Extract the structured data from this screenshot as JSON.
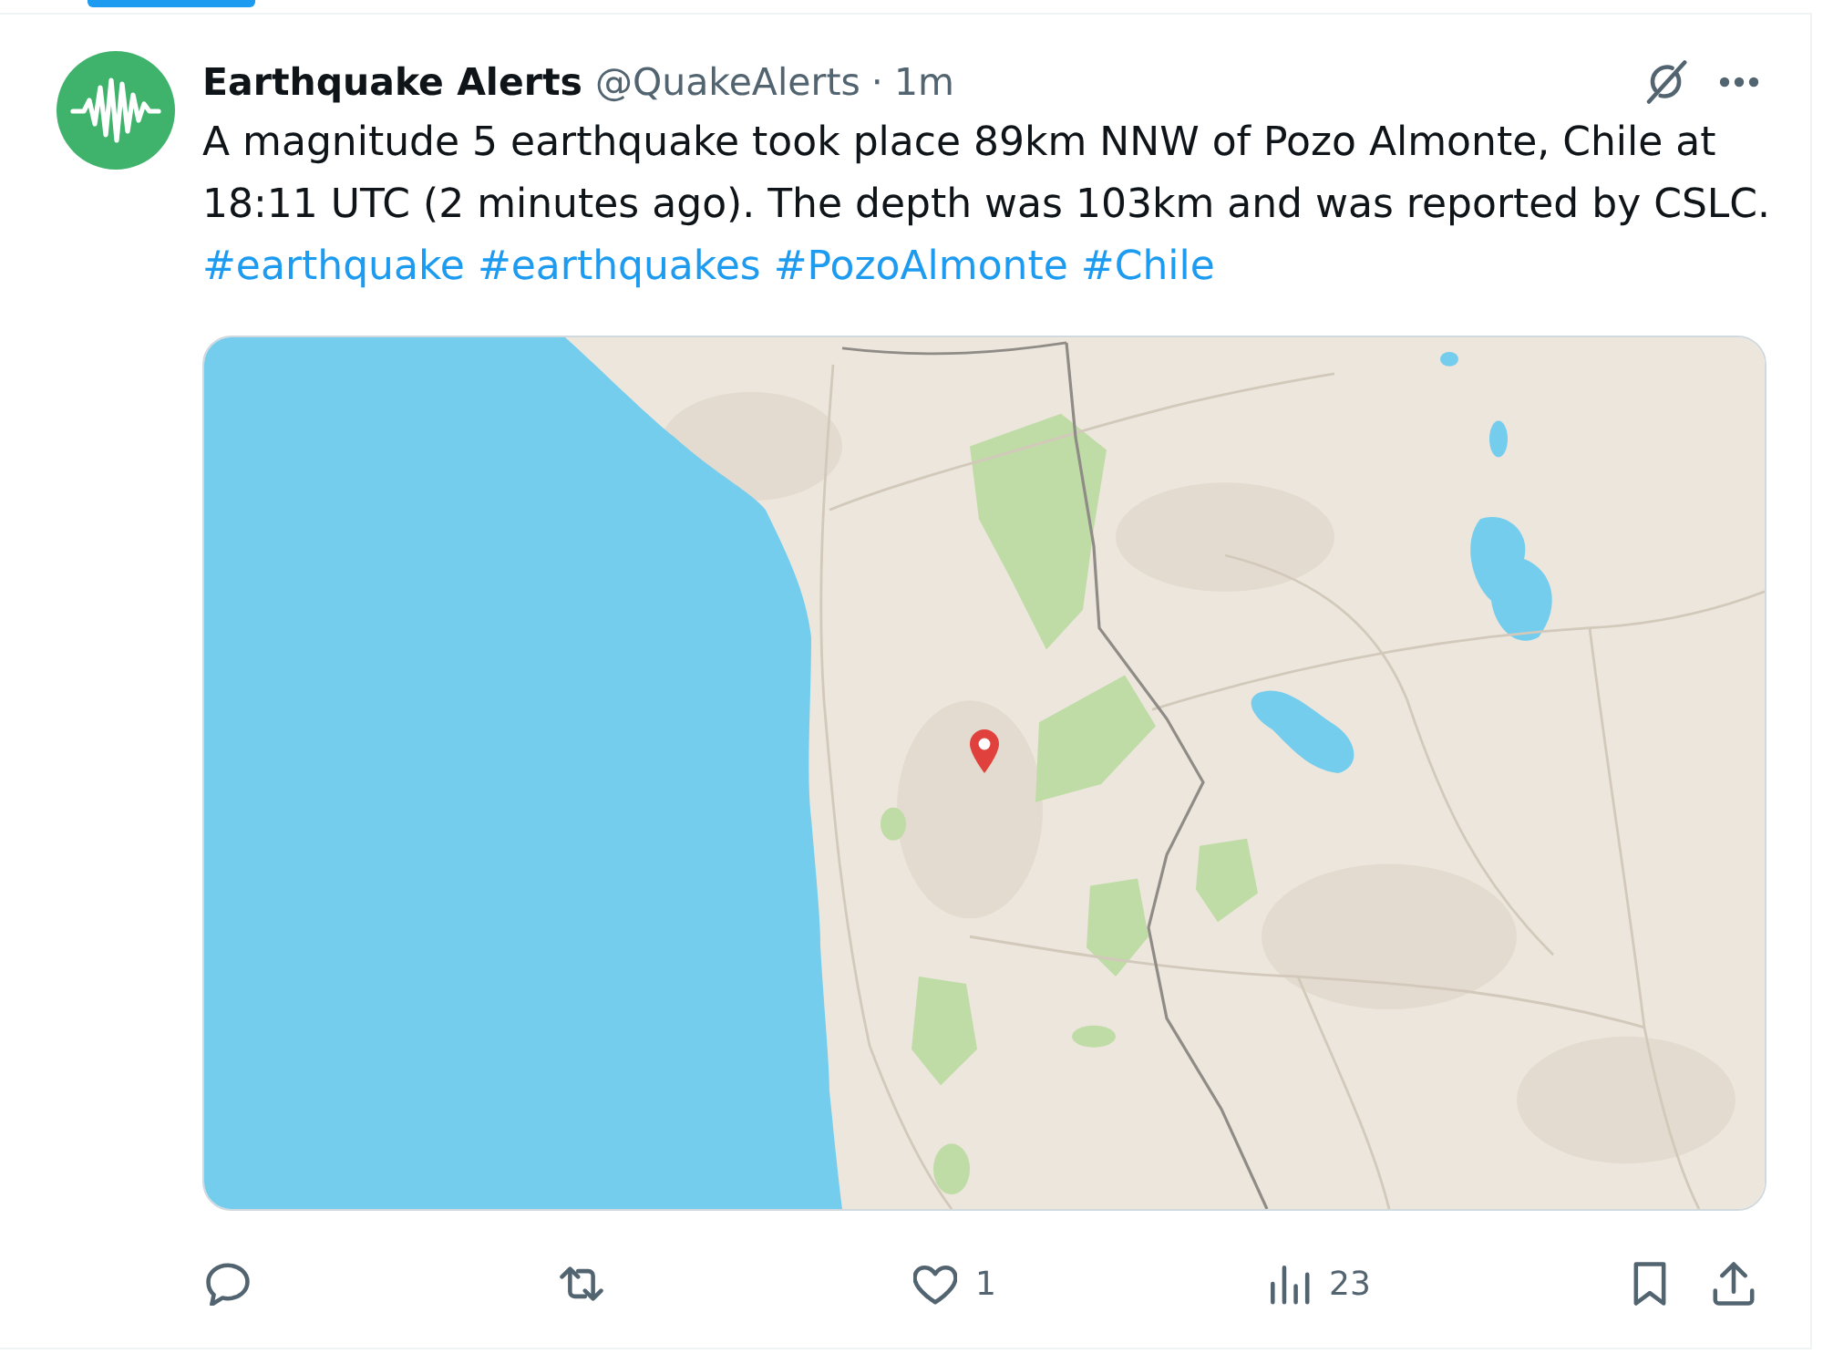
{
  "post": {
    "author": {
      "name": "Earthquake Alerts",
      "handle": "@QuakeAlerts"
    },
    "separator": "·",
    "time": "1m",
    "header_actions": [
      {
        "kind": "slash"
      },
      {
        "kind": "more"
      }
    ],
    "text": "A magnitude 5 earthquake took place 89km NNW of Pozo Almonte, Chile at 18:11 UTC (2 minutes ago). The depth was 103km and was reported by CSLC.",
    "hashtags": [
      "#earthquake",
      "#earthquakes",
      "#PozoAlmonte",
      "#Chile"
    ],
    "media": {
      "kind": "map"
    },
    "actions": [
      {
        "kind": "reply"
      },
      {
        "kind": "repost"
      },
      {
        "kind": "like",
        "count": "1"
      },
      {
        "kind": "views",
        "count": "23"
      },
      {
        "kind": "bookmark"
      },
      {
        "kind": "share"
      }
    ]
  }
}
